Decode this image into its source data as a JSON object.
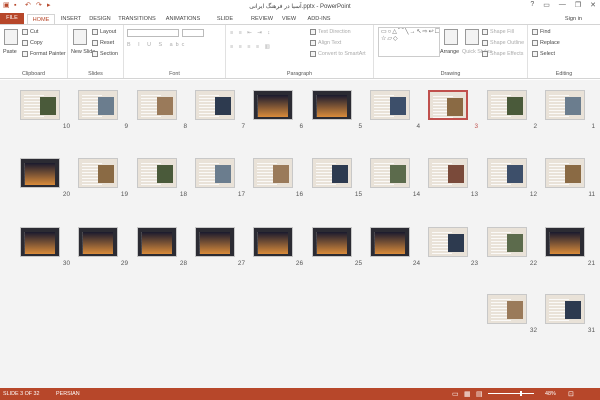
{
  "window": {
    "title": "آسیا در فرهنگ ایرانی.pptx - PowerPoint",
    "controls": [
      "?",
      "▭",
      "—",
      "❐",
      "✕"
    ]
  },
  "tabs": [
    "FILE",
    "HOME",
    "INSERT",
    "DESIGN",
    "TRANSITIONS",
    "ANIMATIONS",
    "SLIDE SHOW",
    "REVIEW",
    "VIEW",
    "ADD-INS"
  ],
  "signin": "Sign in",
  "ribbon": {
    "clipboard": {
      "paste": "Paste",
      "cut": "Cut",
      "copy": "Copy",
      "format_painter": "Format Painter",
      "label": "Clipboard"
    },
    "slides": {
      "new_slide": "New Slide",
      "layout": "Layout",
      "reset": "Reset",
      "section": "Section",
      "label": "Slides"
    },
    "font": {
      "label": "Font"
    },
    "paragraph": {
      "text_direction": "Text Direction",
      "align_text": "Align Text",
      "convert": "Convert to SmartArt",
      "label": "Paragraph"
    },
    "drawing": {
      "arrange": "Arrange",
      "quick_styles": "Quick Styles",
      "shape_fill": "Shape Fill",
      "shape_outline": "Shape Outline",
      "shape_effects": "Shape Effects",
      "label": "Drawing"
    },
    "editing": {
      "find": "Find",
      "replace": "Replace",
      "select": "Select",
      "label": "Editing"
    }
  },
  "slides": {
    "selected": "3",
    "numbers": [
      "1",
      "2",
      "3",
      "4",
      "5",
      "6",
      "7",
      "8",
      "9",
      "10",
      "11",
      "12",
      "13",
      "14",
      "15",
      "16",
      "17",
      "18",
      "19",
      "20",
      "21",
      "22",
      "23",
      "24",
      "25",
      "26",
      "27",
      "28",
      "29",
      "30",
      "31",
      "32"
    ]
  },
  "status": {
    "slide": "SLIDE 3 OF 32",
    "language": "PERSIAN",
    "zoom": "48%"
  },
  "colors": {
    "accent": "#b7472a",
    "selection": "#c0504d"
  }
}
